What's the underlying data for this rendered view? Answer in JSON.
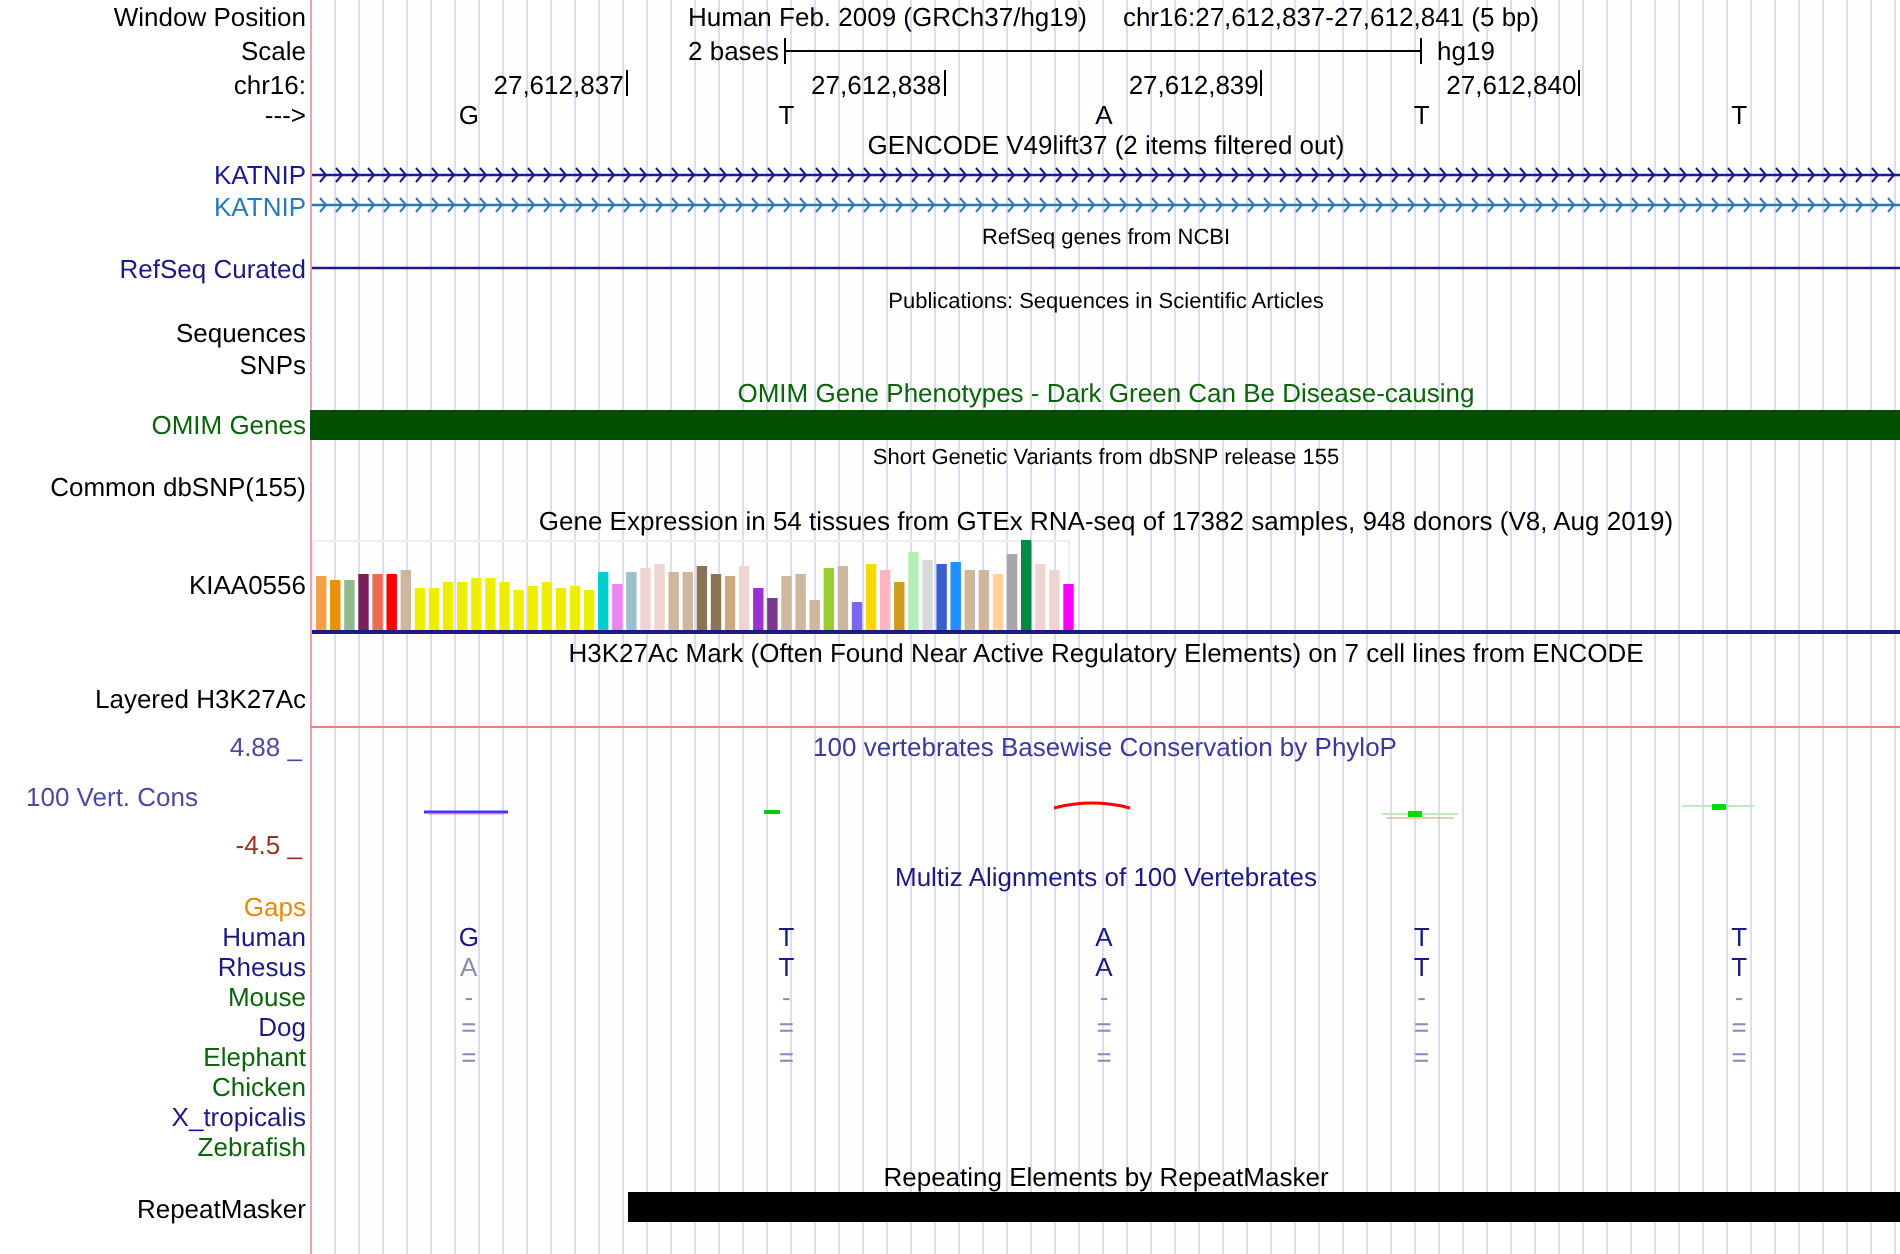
{
  "position": {
    "label": "Window Position",
    "assembly": "Human Feb. 2009 (GRCh37/hg19)",
    "range": "chr16:27,612,837-27,612,841 (5 bp)"
  },
  "scale": {
    "label": "Scale",
    "length": "2 bases",
    "genome": "hg19"
  },
  "ruler": {
    "label": "chr16:",
    "ticks": [
      "27,612,837",
      "27,612,838",
      "27,612,839",
      "27,612,840"
    ]
  },
  "strand": {
    "label": "--->",
    "bases": [
      "G",
      "T",
      "A",
      "T",
      "T"
    ]
  },
  "tracks": [
    {
      "kind": "genes",
      "title": "GENCODE V49lift37 (2 items filtered out)",
      "rows": [
        {
          "label": "KATNIP",
          "color": "#1a1a8c"
        },
        {
          "label": "KATNIP",
          "color": "#2a7ab8"
        }
      ]
    },
    {
      "kind": "line",
      "title": "RefSeq genes from NCBI",
      "rows": [
        {
          "label": "RefSeq Curated"
        }
      ]
    },
    {
      "kind": "empty",
      "title": "Publications: Sequences in Scientific Articles",
      "rows": [
        {
          "label": "Sequences"
        },
        {
          "label": "SNPs"
        }
      ]
    },
    {
      "kind": "bar",
      "title": "OMIM Gene Phenotypes - Dark Green Can Be Disease-causing",
      "rows": [
        {
          "label": "OMIM Genes"
        }
      ]
    },
    {
      "kind": "empty",
      "title": "Short Genetic Variants from dbSNP release 155",
      "rows": [
        {
          "label": "Common dbSNP(155)"
        }
      ]
    },
    {
      "kind": "expression",
      "title": "Gene Expression in 54 tissues from GTEx RNA-seq of 17382 samples, 948 donors (V8, Aug 2019)",
      "rows": [
        {
          "label": "KIAA0556"
        }
      ]
    },
    {
      "kind": "layered",
      "title": "H3K27Ac Mark (Often Found Near Active Regulatory Elements) on 7 cell lines from ENCODE",
      "rows": [
        {
          "label": "Layered H3K27Ac"
        }
      ]
    },
    {
      "kind": "wiggle",
      "title": "100 vertebrates Basewise Conservation by PhyloP",
      "rows": [
        {
          "label": "100 Vert. Cons",
          "max": "4.88 _",
          "min": "-4.5 _"
        }
      ]
    },
    {
      "kind": "alignment",
      "title": "Multiz Alignments of 100 Vertebrates",
      "rows": [
        {
          "label": "Gaps",
          "color": "#e8890c"
        },
        {
          "label": "Human",
          "color": "#1a1a80",
          "bases": [
            {
              "text": "G",
              "match": true
            },
            {
              "text": "T",
              "match": true
            },
            {
              "text": "A",
              "match": true
            },
            {
              "text": "T",
              "match": true
            },
            {
              "text": "T",
              "match": true
            }
          ]
        },
        {
          "label": "Rhesus",
          "color": "#1a1a80",
          "bases": [
            {
              "text": "A",
              "match": false
            },
            {
              "text": "T",
              "match": true
            },
            {
              "text": "A",
              "match": true
            },
            {
              "text": "T",
              "match": true
            },
            {
              "text": "T",
              "match": true
            }
          ]
        },
        {
          "label": "Mouse",
          "color": "#0a640a",
          "bases": [
            {
              "text": "-",
              "match": false
            },
            {
              "text": "-",
              "match": false
            },
            {
              "text": "-",
              "match": false
            },
            {
              "text": "-",
              "match": false
            },
            {
              "text": "-",
              "match": false
            }
          ]
        },
        {
          "label": "Dog",
          "color": "#1a1a80",
          "bases": [
            {
              "text": "=",
              "match": false
            },
            {
              "text": "=",
              "match": false
            },
            {
              "text": "=",
              "match": false
            },
            {
              "text": "=",
              "match": false
            },
            {
              "text": "=",
              "match": false
            }
          ]
        },
        {
          "label": "Elephant",
          "color": "#0a640a",
          "bases": [
            {
              "text": "=",
              "match": false
            },
            {
              "text": "=",
              "match": false
            },
            {
              "text": "=",
              "match": false
            },
            {
              "text": "=",
              "match": false
            },
            {
              "text": "=",
              "match": false
            }
          ]
        },
        {
          "label": "Chicken",
          "color": "#0a640a"
        },
        {
          "label": "X_tropicalis",
          "color": "#1a1a80"
        },
        {
          "label": "Zebrafish",
          "color": "#0a640a"
        }
      ]
    },
    {
      "kind": "repeat",
      "title": "Repeating Elements by RepeatMasker",
      "rows": [
        {
          "label": "RepeatMasker"
        }
      ]
    }
  ]
}
